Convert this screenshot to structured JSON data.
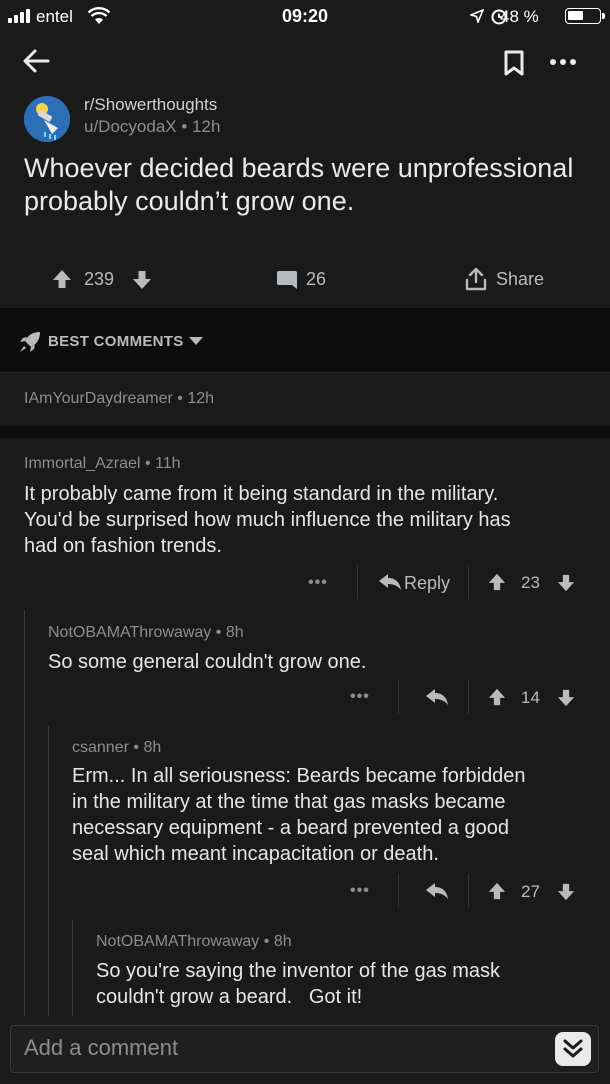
{
  "status_bar": {
    "carrier": "entel",
    "time": "09:20",
    "battery": "48 %"
  },
  "post": {
    "subreddit": "r/Showerthoughts",
    "author": "u/DocyodaX",
    "age": "12h",
    "title": "Whoever decided beards were unprofessional probably couldn’t grow one.",
    "upvotes": "239",
    "comments": "26",
    "share_label": "Share"
  },
  "sort": {
    "label": "BEST COMMENTS"
  },
  "collapsed_comment": {
    "author": "IAmYourDaydreamer",
    "age": "12h"
  },
  "comments": [
    {
      "author": "Immortal_Azrael",
      "age": "11h",
      "lines": [
        "It probably came from it being standard in the military.",
        "You'd be surprised how much influence the military has",
        "had on fashion trends."
      ],
      "reply_label": "Reply",
      "votes": "23"
    },
    {
      "author": "NotOBAMAThrowaway",
      "age": "8h",
      "lines": [
        "So some general couldn't grow one."
      ],
      "votes": "14"
    },
    {
      "author": "csanner",
      "age": "8h",
      "lines": [
        "Erm... In all seriousness: Beards became forbidden",
        "in the military at the time that gas masks became",
        "necessary equipment - a beard prevented a good",
        "seal which meant incapacitation or death."
      ],
      "votes": "27"
    },
    {
      "author": "NotOBAMAThrowaway",
      "age": "8h",
      "lines": [
        "So you're saying the inventor of the gas mask",
        "couldn't grow a beard.   Got it!"
      ]
    }
  ],
  "comment_box": {
    "placeholder": "Add a comment"
  },
  "meta_sep": "•",
  "more_dots": "•••"
}
